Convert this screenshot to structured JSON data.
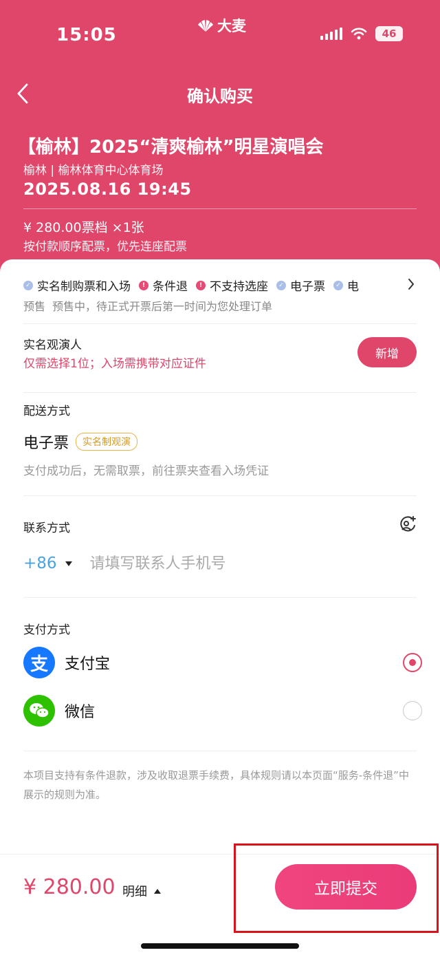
{
  "status_bar": {
    "time": "15:05",
    "brand": "大麦",
    "battery": "46"
  },
  "nav": {
    "title": "确认购买"
  },
  "event": {
    "title": "【榆林】2025“清爽榆林”明星演唱会",
    "venue": "榆林 | 榆林体育中心体育场",
    "datetime": "2025.08.16 19:45",
    "price_line": "¥ 280.00票档  ×1张",
    "seat_note": "按付款顺序配票，优先连座配票"
  },
  "tags": [
    {
      "label": "实名制购票和入场",
      "type": "ok"
    },
    {
      "label": "条件退",
      "type": "warn"
    },
    {
      "label": "不支持选座",
      "type": "warn"
    },
    {
      "label": "电子票",
      "type": "ok"
    },
    {
      "label": "电",
      "type": "ok"
    }
  ],
  "presale": {
    "label": "预售",
    "text": "预售中，待正式开票后第一时间为您处理订单"
  },
  "viewer": {
    "title": "实名观演人",
    "hint": "仅需选择1位；入场需携带对应证件",
    "add_label": "新增"
  },
  "delivery": {
    "title": "配送方式",
    "method": "电子票",
    "badge": "实名制观演",
    "note": "支付成功后，无需取票，前往票夹查看入场凭证"
  },
  "contact": {
    "title": "联系方式",
    "country_code": "+86",
    "placeholder": "请填写联系人手机号"
  },
  "payment": {
    "title": "支付方式",
    "options": [
      {
        "name": "支付宝",
        "icon": "alipay-icon",
        "glyph": "支",
        "selected": true
      },
      {
        "name": "微信",
        "icon": "wechat-icon",
        "glyph": "",
        "selected": false
      }
    ]
  },
  "refund_note": "本项目支持有条件退款，涉及收取退票手续费，具体规则请以本页面“服务-条件退”中展示的规则为准。",
  "footer": {
    "total": "¥ 280.00",
    "detail_label": "明细",
    "submit_label": "立即提交"
  },
  "colors": {
    "brand": "#e0456a",
    "accent_blue": "#4aa3e0",
    "highlight": "#d9111b"
  }
}
